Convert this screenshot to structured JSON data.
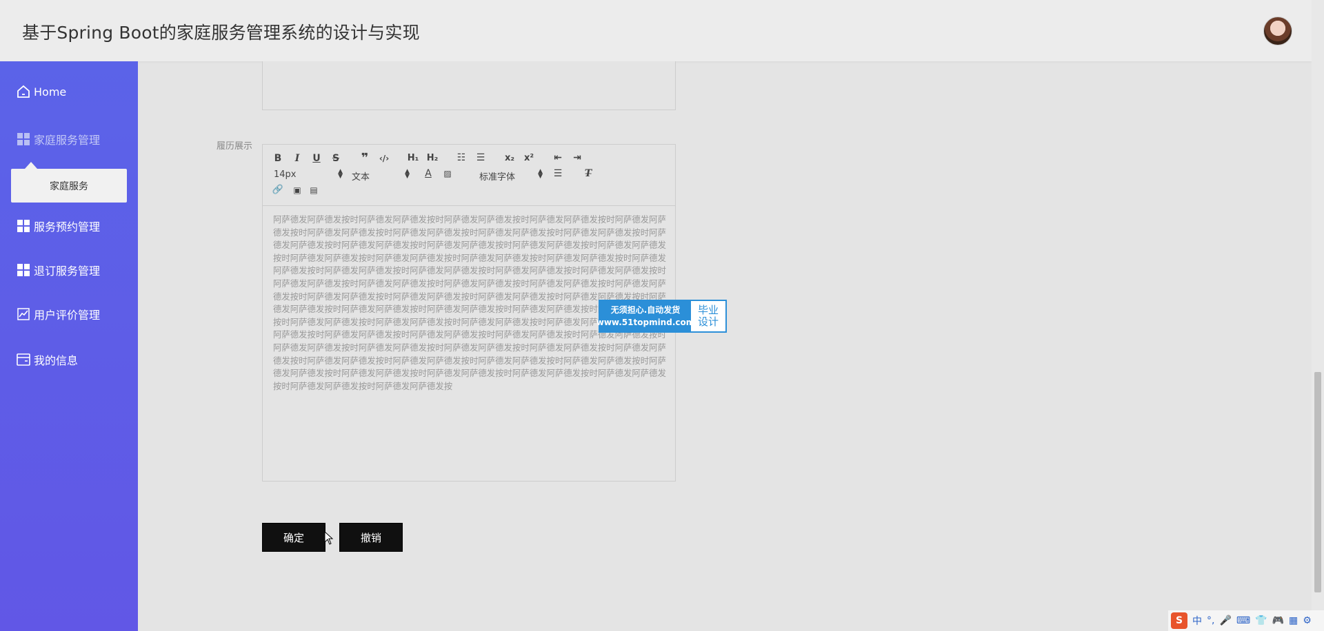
{
  "header": {
    "title": "基于Spring Boot的家庭服务管理系统的设计与实现"
  },
  "sidebar": {
    "items": [
      {
        "label": "Home",
        "icon": "home-icon"
      },
      {
        "label": "家庭服务管理",
        "icon": "grid-icon"
      },
      {
        "label": "服务预约管理",
        "icon": "grid-icon"
      },
      {
        "label": "退订服务管理",
        "icon": "grid-icon"
      },
      {
        "label": "用户评价管理",
        "icon": "chart-icon"
      },
      {
        "label": "我的信息",
        "icon": "card-icon"
      }
    ],
    "submenu": {
      "label": "家庭服务"
    }
  },
  "form": {
    "resume_label": "履历展示",
    "editor": {
      "font_size": "14px",
      "header_select": "文本",
      "font_family": "标准字体",
      "content": "阿萨德发阿萨德发按时阿萨德发阿萨德发按时阿萨德发阿萨德发按时阿萨德发阿萨德发按时阿萨德发阿萨德发按时阿萨德发阿萨德发按时阿萨德发阿萨德发按时阿萨德发阿萨德发按时阿萨德发阿萨德发按时阿萨德发阿萨德发按时阿萨德发阿萨德发按时阿萨德发阿萨德发按时阿萨德发阿萨德发按时阿萨德发阿萨德发按时阿萨德发阿萨德发按时阿萨德发阿萨德发按时阿萨德发阿萨德发按时阿萨德发阿萨德发按时阿萨德发阿萨德发按时阿萨德发阿萨德发按时阿萨德发阿萨德发按时阿萨德发阿萨德发按时阿萨德发阿萨德发按时阿萨德发阿萨德发按时阿萨德发阿萨德发按时阿萨德发阿萨德发按时阿萨德发阿萨德发按时阿萨德发阿萨德发按时阿萨德发阿萨德发按时阿萨德发阿萨德发按时阿萨德发阿萨德发按时阿萨德发阿萨德发按时阿萨德发阿萨德发按时阿萨德发阿萨德发按时阿萨德发阿萨德发按时阿萨德发阿萨德发按时阿萨德发阿萨德发按时阿萨德发阿萨德发按时阿萨德发阿萨德发按时阿萨德发阿萨德发按时阿萨德发阿萨德发按时阿萨德发阿萨德发按时阿萨德发阿萨德发按时阿萨德发阿萨德发按时阿萨德发阿萨德发按时阿萨德发阿萨德发按时阿萨德发阿萨德发按时阿萨德发阿萨德发按时阿萨德发阿萨德发按时阿萨德发阿萨德发按时阿萨德发阿萨德发按时阿萨德发阿萨德发按时阿萨德发阿萨德发按时阿萨德发阿萨德发按时阿萨德发阿萨德发按时阿萨德发阿萨德发按时阿萨德发阿萨德发按时阿萨德发阿萨德发按时阿萨德发阿萨德发按时阿萨德发阿萨德发按时阿萨德发阿萨德发按时阿萨德发阿萨德发按"
    },
    "confirm_label": "确定",
    "cancel_label": "撤销"
  },
  "watermark": {
    "line1": "无须担心.自动发货",
    "line2": "www.51topmind.com",
    "right1": "毕业",
    "right2": "设计"
  },
  "ime": {
    "mode": "中",
    "punct": "°,"
  }
}
